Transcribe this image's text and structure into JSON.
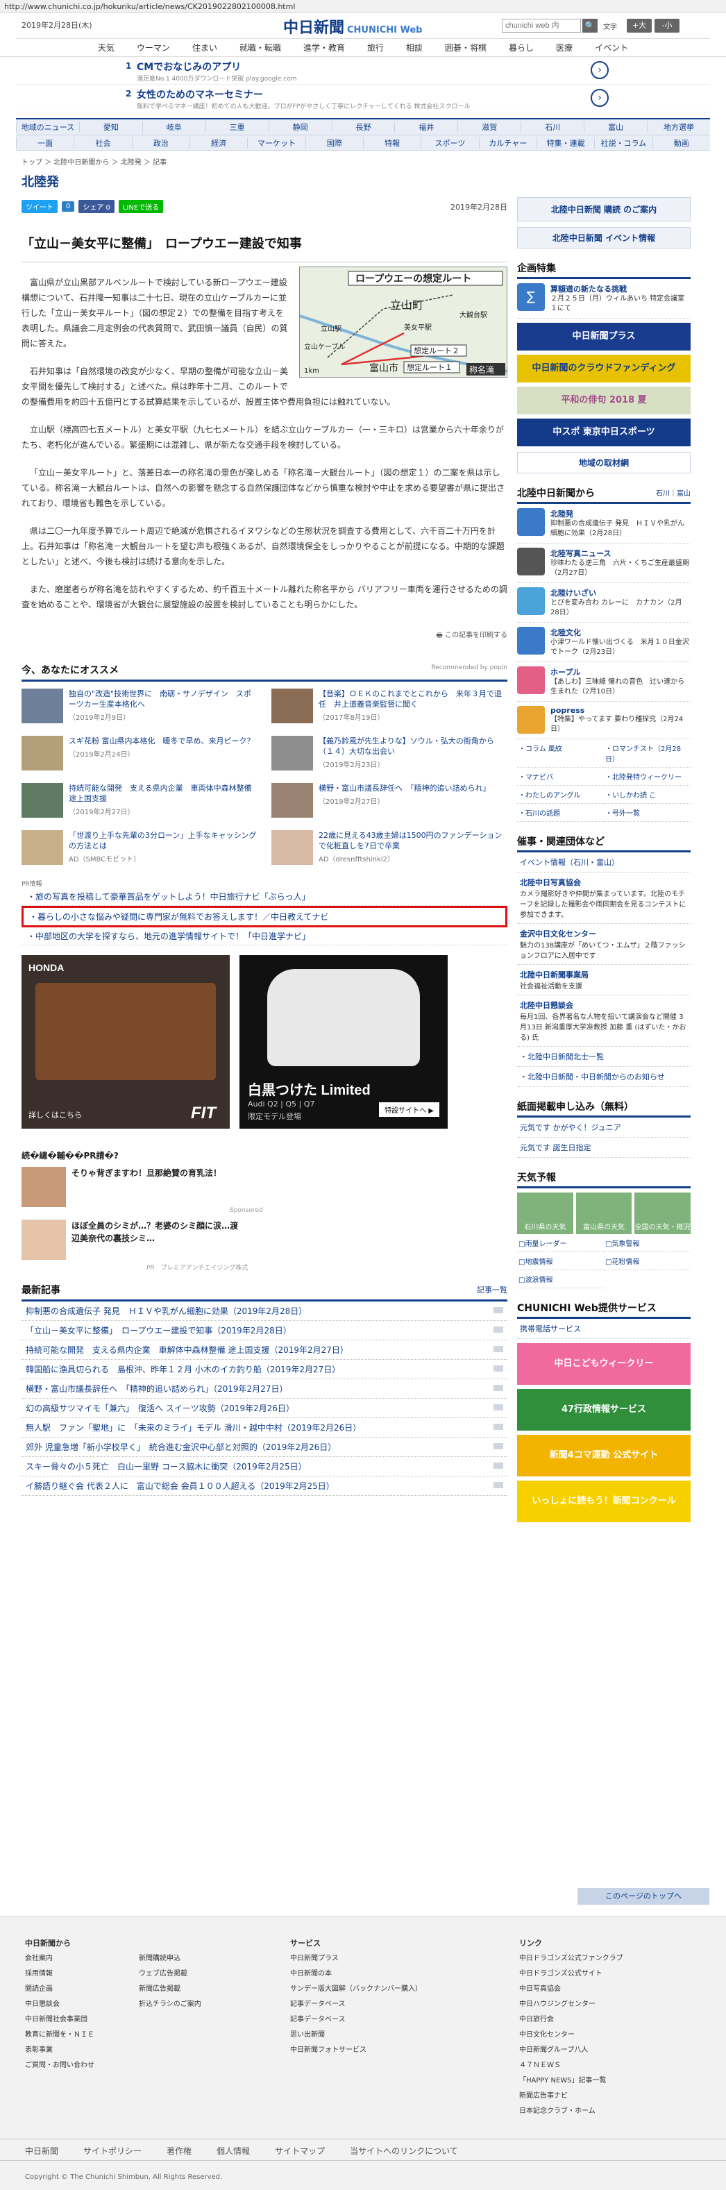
{
  "url": "http://www.chunichi.co.jp/hokuriku/article/news/CK2019022802100008.html",
  "header": {
    "date": "2019年2月28日(木)",
    "logo": "中日新聞",
    "logo_sub": "CHUNICHI Web",
    "search_placeholder": "chunichi web 内",
    "search_button": "🔍",
    "font_label": "文字",
    "font_plus": "+大",
    "font_minus": "-小"
  },
  "gnav": [
    "天気",
    "ウーマン",
    "住まい",
    "就職・転職",
    "進学・教育",
    "旅行",
    "相談",
    "囲碁・将棋",
    "暮らし",
    "医療",
    "イベント"
  ],
  "ads": [
    {
      "num": "1",
      "title": "CMでおなじみのアプリ",
      "sub": "満足度No.1 4000万ダウンロード突破 play.google.com"
    },
    {
      "num": "2",
      "title": "女性のためのマネーセミナー",
      "sub": "無料で学べるマネー講座！初めての人も大歓迎。プロがFPがやさしく丁寧にレクチャーしてくれる 株式会社スクロール"
    }
  ],
  "catnav": {
    "row1": [
      "地域のニュース",
      "愛知",
      "岐阜",
      "三重",
      "静岡",
      "長野",
      "福井",
      "滋賀",
      "石川",
      "富山",
      "地方選挙"
    ],
    "row2": [
      "一面",
      "社会",
      "政治",
      "経済",
      "マーケット",
      "国際",
      "特報",
      "スポーツ",
      "カルチャー",
      "特集・連載",
      "社説・コラム",
      "動画"
    ]
  },
  "breadcrumb": "トップ ＞ 北陸中日新聞から ＞ 北陸発 ＞ 記事",
  "page_title": "北陸発",
  "social": {
    "tweet": "ツイート",
    "b": "0",
    "share": "シェア 0",
    "line": "LINEで送る"
  },
  "article": {
    "date": "2019年2月28日",
    "headline": "「立山－美女平に整備」　ロープウエー建設で知事",
    "paras": [
      "富山県が立山黒部アルペンルートで検討している新ロープウエー建設構想について、石井隆一知事は二十七日、現在の立山ケーブルカーに並行した「立山－美女平ルート」（図の想定２）での整備を目指す考えを表明した。県議会二月定例会の代表質問で、武田慎一議員（自民）の質問に答えた。",
      "石井知事は「自然環境の改変が少なく、早期の整備が可能な立山－美女平間を優先して検討する」と述べた。県は昨年十二月、このルートでの整備費用を約四十五億円とする試算結果を示しているが、設置主体や費用負担には触れていない。",
      "立山駅（標高四七五メートル）と美女平駅（九七七メートル）を結ぶ立山ケーブルカー（一・三キロ）は営業から六十年余りがたち、老朽化が進んでいる。繁盛期には混雑し、県が新たな交通手段を検討している。",
      "「立山－美女平ルート」と、落差日本一の称名滝の景色が楽しめる「称名滝－大観台ルート」（図の想定１）の二案を県は示している。称名滝－大観台ルートは、自然への影響を懸念する自然保護団体などから慎重な検討や中止を求める要望書が県に提出されており、環境省も難色を示している。",
      "県は二〇一九年度予算でルート周辺で絶滅が危惧されるイヌワシなどの生態状況を調査する費用として、六千百二十万円を計上。石井知事は「称名滝－大観台ルートを望む声も根強くあるが、自然環境保全をしっかりやることが前提になる。中期的な課題としたい」と述べ、今後も検討は続ける意向を示した。",
      "また、磨崖者らが称名滝を訪れやすくするため、約千百五十メートル離れた称名平から バリアフリー車両を運行させるための調査を始めることや、環境省が大観台に展望施設の設置を検討していることも明らかにした。"
    ],
    "map": {
      "title": "ロープウエーの想定ルート",
      "tateyamacho": "立山町",
      "daikandai": "大観台駅",
      "tateyama": "立山駅",
      "bijodaira": "美女平駅",
      "route1": "想定ルート１",
      "route2": "想定ルート２",
      "toyama": "富山市",
      "shomyo": "称名滝",
      "scale": "1km",
      "cable": "立山ケーブル"
    },
    "print": "この記事を印刷する"
  },
  "recommend": {
    "title": "今、あなたにオススメ",
    "powered": "Recommended by popIn",
    "items": [
      {
        "title": "独自の\"改造\"技術世界に　南砺・サノデザイン　スポーツカー生産本格化へ",
        "date": "（2019年2月9日）"
      },
      {
        "title": "【音楽】ＯＥＫのこれまでとこれから　来年３月で退任　井上道義音楽監督に聞く",
        "date": "（2017年8月19日）"
      },
      {
        "title": "スギ花粉 富山県内本格化　暖冬で早め、来月ピーク？",
        "date": "（2019年2月24日）"
      },
      {
        "title": "【義乃鈴風が先生よりな】ソウル・弘大の街角から（１４）大切な出会い",
        "date": "（2019年2月23日）"
      },
      {
        "title": "持続可能な開発　支える県内企業　車両体中森林整備 途上国支援",
        "date": "（2019年2月27日）"
      },
      {
        "title": "横野・富山市議長辞任へ　「精神的追い詰められ」",
        "date": "（2019年2月27日）"
      },
      {
        "title": "「世渡り上手な先輩の3分ローン」上手なキャッシングの方法とは",
        "date": "AD（SMBCモビット）"
      },
      {
        "title": "22歳に見える43歳主婦は1500円のファンデーションで化粧直しを7日で卒業",
        "date": "AD（dresnfftshinki2）"
      }
    ]
  },
  "pr": {
    "label": "PR情報",
    "items": [
      "旅の写真を投稿して豪華賞品をゲットしよう！中日旅行ナビ「ぶらっ人」",
      "暮らしの小さな悩みや疑問に専門家が無料でお答えします！／中日教えてナビ",
      "中部地区の大学を探すなら、地元の進学情報サイトで！「中日進学ナビ」"
    ]
  },
  "bigads": {
    "honda": "HONDA",
    "honda_link": "詳しくはこちら",
    "fit": "FIT",
    "audi_title": "白黒つけた Limited",
    "audi_sub": "Audi Q2 | Q5 | Q7",
    "audi_sub2": "限定モデル登場",
    "audi_btn": "特設サイトへ ▶"
  },
  "sponsored": {
    "head": "続�總�輔��PR請�?",
    "items": [
      "そりゃ背ぎますわ！旦那絶賛の育乳法！",
      "ほぼ全員のシミが…？老婆のシミ顔に涙…渡辺美奈代の裏技シミ…"
    ],
    "label": "Sponsored",
    "credit": "PR　プレミアアンチエイジング株式"
  },
  "latest": {
    "title": "最新記事",
    "more": "記事一覧",
    "items": [
      "抑制悪の合成遺伝子 発見　ＨＩＶや乳がん細胞に効果（2019年2月28日）",
      "「立山－美女平に整備」　ロープウエー建設で知事（2019年2月28日）",
      "持続可能な開発　支える県内企業　車解体中森林整備 途上国支援（2019年2月27日）",
      "韓国船に漁具切られる　島根沖、昨年１２月 小木のイカ釣り船（2019年2月27日）",
      "横野・富山市議長辞任へ　「精神的追い詰められ」（2019年2月27日）",
      "幻の高級サツマイモ「兼六」　復活へ スイーツ攻勢（2019年2月26日）",
      "無人駅　ファン「聖地」に　「未来のミライ」モデル 滑川・越中中村（2019年2月26日）",
      "郊外 児童急増「新小学校早く」　統合進む金沢中心部と対照的（2019年2月26日）",
      "スキー骨々の小５死亡　白山一里野 コース脇木に衝突（2019年2月25日）",
      "イ勝語り継ぐ会 代表２人に　富山で総会 会員１００人超える（2019年2月25日）"
    ]
  },
  "right": {
    "subscribe": "北陸中日新聞 購読 のご案内",
    "event": "北陸中日新聞 イベント情報",
    "kikaku_title": "企画特集",
    "kikaku_item": "算額道の新たなる挑戦",
    "kikaku_desc": "２月２５日（月）ウィルあいち 特定会議室１にて",
    "banners": [
      "中日新聞プラス",
      "中日新聞のクラウドファンディング",
      "平和の俳句 2018 夏",
      "中スポ 東京中日スポーツ"
    ],
    "chiiki": "地域の取材網",
    "hokuriku_title": "北陸中日新聞から",
    "hokuriku_links": [
      "石川",
      "富山"
    ],
    "hn": [
      {
        "cat": "北陸発",
        "txt": "抑制悪の合成遺伝子 発見　ＨＩＶや乳がん細胞に効果（2月28日）"
      },
      {
        "cat": "北陸写真ニュース",
        "txt": "珍味わたる逆三角　六片・くちご生産最盛期（2月27日）"
      },
      {
        "cat": "北陸けいざい",
        "txt": "とびを変み合わ カレーに　カナカン（2月28日）"
      },
      {
        "cat": "北陸文化",
        "txt": "小津ワールド懐い出づくる　米月１０日金沢でトーク（2月23日）"
      },
      {
        "cat": "ホープル",
        "txt": "【あしわ】三味線 懐れの音色　辻い達から生まれた（2月10日）"
      },
      {
        "cat": "popress",
        "txt": "【特集】やってます 要わり種探究（2月24日）"
      }
    ],
    "w2": [
      "コラム 風紋",
      "ロマンチスト（2月28日）",
      "マナビバ",
      "北陸発特ウィークリー",
      "わたしのアングル",
      "いしかわ読 こ",
      "石川の話題",
      "号外一覧"
    ],
    "group_title": "催事・関連団体など",
    "group_sub": "イベント情報（石川・富山）",
    "group_items": [
      {
        "t": "北陸中日写真協会",
        "d": "カメラ撮影好きや仲間が集まっています。北陸のモチーフを記録した撮影会や雨同期会を見るコンテストに参加できます。"
      },
      {
        "t": "金沢中日文化センター",
        "d": "魅力の138講座が「めいてつ・エムザ」２階ファッションフロアに入居中です"
      },
      {
        "t": "北陸中日新聞事業局",
        "d": "社会福祉活動を支援"
      },
      {
        "t": "北陸中日懇談会",
        "d": "毎月1回、各界著名な人物を招いて講演会など開催 3月13日 新潟重厚大学准教授 加藤 重 (はずいた・かおる) 氏"
      }
    ],
    "group_more": [
      "北陸中日新聞北士一覧",
      "北陸中日新聞・中日新聞からのお知らせ"
    ],
    "apply_title": "紙面掲載申し込み（無料）",
    "apply_items": [
      "元気です かがやく！ジュニア",
      "元気です 誕生日指定"
    ],
    "weather_title": "天気予報",
    "weather": [
      "石川県の天気",
      "富山県の天気",
      "全国の天気・概況"
    ],
    "weather_items": [
      "雨量レーダー",
      "気象警報",
      "地震情報",
      "花粉情報",
      "波浪情報"
    ],
    "service_title": "CHUNICHI Web提供サービス",
    "service_item": "携帯電話サービス",
    "svc_banners": [
      "中日こどもウィークリー",
      "47行政情報サービス",
      "新聞4コマ運動 公式サイト",
      "いっしょに読もう！新聞コンクール"
    ]
  },
  "footer": {
    "totop": "このページのトップへ",
    "cols": [
      {
        "head": "中日新聞から",
        "items": [
          "会社案内",
          "採用情報",
          "閲読企画",
          "中日懇談会",
          "中日新聞社会事業団",
          "教育に新聞を・ＮＩＥ",
          "表彰事業",
          "ご質問・お問い合わせ"
        ]
      },
      {
        "head": "",
        "items": [
          "新聞購読申込",
          "ウェブ広告掲載",
          "新聞広告掲載",
          "折込チラシのご案内"
        ]
      },
      {
        "head": "サービス",
        "items": [
          "中日新聞プラス",
          "中日新聞の本",
          "サンデー版大図解（バックナンバー購入）",
          "記事データベース",
          "記事データベース",
          "思い出新聞",
          "中日新聞フォトサービス"
        ]
      },
      {
        "head": "リンク",
        "items": [
          "中日ドラゴンズ公式ファンクラブ",
          "中日ドラゴンズ公式サイト",
          "中日写真協会",
          "中日ハウジングセンター",
          "中日旅行会",
          "中日文化センター",
          "中日新聞グループ八人",
          "４７ＮＥＷＳ",
          "「HAPPY NEWS」記事一覧",
          "新聞広告事ナビ",
          "日本記念クラブ・ホーム"
        ]
      }
    ],
    "bar": [
      "中日新聞",
      "サイトポリシー",
      "著作権",
      "個人情報",
      "サイトマップ",
      "当サイトへのリンクについて"
    ],
    "copyright": "Copyright © The Chunichi Shimbun, All Rights Reserved."
  },
  "colors": {
    "brand": "#123e8a",
    "highlight": "#e01010"
  }
}
